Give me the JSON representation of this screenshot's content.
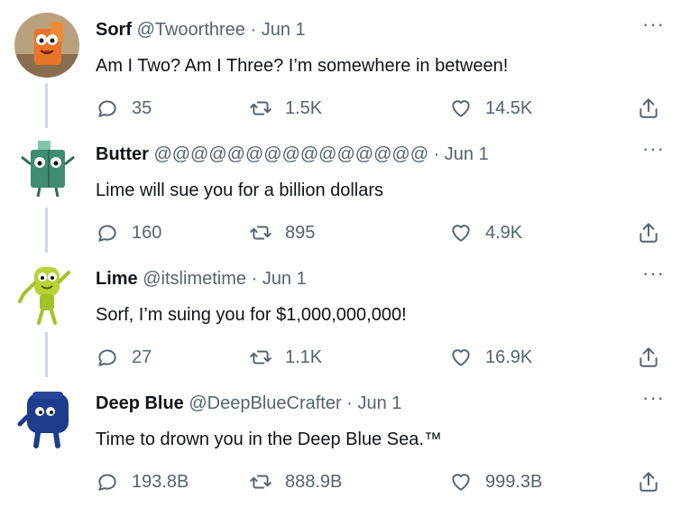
{
  "tweets": [
    {
      "name": "Sorf",
      "handle": "@Twoorthree",
      "date": "Jun 1",
      "text": "Am I Two? Am I Three? I’m somewhere in between!",
      "replies": "35",
      "retweets": "1.5K",
      "likes": "14.5K",
      "avatar_icon": "sorf-character-avatar"
    },
    {
      "name": "Butter",
      "handle": "@@@@@@@@@@@@@@@",
      "date": "Jun 1",
      "text": "Lime will sue you for a billion dollars",
      "replies": "160",
      "retweets": "895",
      "likes": "4.9K",
      "avatar_icon": "butter-character-avatar"
    },
    {
      "name": "Lime",
      "handle": "@itslimetime",
      "date": "Jun 1",
      "text": "Sorf, I’m suing you for $1,000,000,000!",
      "replies": "27",
      "retweets": "1.1K",
      "likes": "16.9K",
      "avatar_icon": "lime-character-avatar"
    },
    {
      "name": "Deep Blue",
      "handle": "@DeepBlueCrafter",
      "date": "Jun 1",
      "text": "Time to drown you in the Deep Blue Sea.™",
      "replies": "193.8B",
      "retweets": "888.9B",
      "likes": "999.3B",
      "avatar_icon": "deep-blue-character-avatar"
    }
  ],
  "separator": "·",
  "more_label": "···",
  "colors": {
    "text": "#0f1419",
    "secondary": "#536471",
    "thread_line": "#cfd9de"
  }
}
